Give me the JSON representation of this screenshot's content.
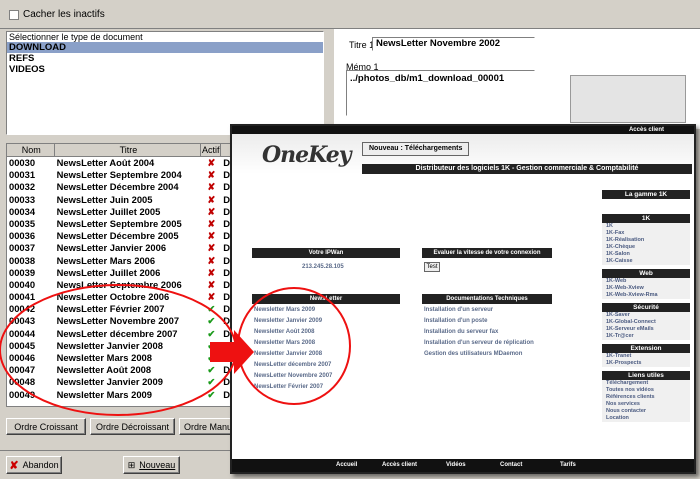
{
  "top": {
    "hide_inactive": "Cacher les inactifs"
  },
  "doc_types": {
    "label": "Sélectionner le type de document",
    "items": [
      "DOWNLOAD",
      "REFS",
      "VIDEOS"
    ]
  },
  "columns": {
    "nom": "Nom",
    "titre": "Titre",
    "actif": "Actif",
    "extra": "D"
  },
  "rows": [
    {
      "nom": "00030",
      "titre": "NewsLetter Août 2004",
      "actif": "✘"
    },
    {
      "nom": "00031",
      "titre": "NewsLetter Septembre 2004",
      "actif": "✘"
    },
    {
      "nom": "00032",
      "titre": "NewsLetter Décembre 2004",
      "actif": "✘"
    },
    {
      "nom": "00033",
      "titre": "NewsLetter Juin 2005",
      "actif": "✘"
    },
    {
      "nom": "00034",
      "titre": "NewsLetter Juillet 2005",
      "actif": "✘"
    },
    {
      "nom": "00035",
      "titre": "NewsLetter Septembre 2005",
      "actif": "✘"
    },
    {
      "nom": "00036",
      "titre": "NewsLetter Décembre 2005",
      "actif": "✘"
    },
    {
      "nom": "00037",
      "titre": "NewsLetter Janvier 2006",
      "actif": "✘"
    },
    {
      "nom": "00038",
      "titre": "NewsLetter Mars 2006",
      "actif": "✘"
    },
    {
      "nom": "00039",
      "titre": "NewsLetter Juillet 2006",
      "actif": "✘"
    },
    {
      "nom": "00040",
      "titre": "NewsLetter Septembre 2006",
      "actif": "✘"
    },
    {
      "nom": "00041",
      "titre": "NewsLetter Octobre 2006",
      "actif": "✘"
    },
    {
      "nom": "00042",
      "titre": "NewsLetter Février 2007",
      "actif": "✔"
    },
    {
      "nom": "00043",
      "titre": "NewsLetter Novembre 2007",
      "actif": "✔"
    },
    {
      "nom": "00044",
      "titre": "NewsLetter décembre 2007",
      "actif": "✔"
    },
    {
      "nom": "00045",
      "titre": "Newsletter Janvier 2008",
      "actif": "✔"
    },
    {
      "nom": "00046",
      "titre": "Newsletter Mars 2008",
      "actif": "✔"
    },
    {
      "nom": "00047",
      "titre": "Newsletter Août 2008",
      "actif": "✔"
    },
    {
      "nom": "00048",
      "titre": "Newsletter Janvier 2009",
      "actif": "✔"
    },
    {
      "nom": "00049",
      "titre": "Newsletter Mars 2009",
      "actif": "✔"
    }
  ],
  "sort": {
    "asc": "Ordre Croissant",
    "desc": "Ordre Décroissant",
    "manual": "Ordre Manue"
  },
  "bottom": {
    "cancel": "Abandon",
    "new": "Nouveau"
  },
  "detail": {
    "titre_label": "Titre 1",
    "titre_value": "NewsLetter Novembre 2002",
    "memo_label": "Mémo 1",
    "memo_value": "../photos_db/m1_download_00001"
  },
  "web": {
    "espace": "Accès client",
    "nav": "Nouveau : Téléchargements",
    "strip": "Distributeur des logiciels 1K - Gestion commerciale & Comptabilité",
    "ip_head": "Votre IPWan",
    "ip_value": "213.245.28.105",
    "speed_head": "Evaluer la vitesse de votre connexion",
    "test": "Test",
    "news_head": "NewsLetter",
    "news": [
      "Newsletter Mars 2009",
      "Newsletter Janvier 2009",
      "Newsletter Août 2008",
      "Newsletter Mars 2008",
      "Newsletter Janvier 2008",
      "NewsLetter décembre 2007",
      "NewsLetter Novembre 2007",
      "NewsLetter Février 2007"
    ],
    "docs_head": "Documentations Techniques",
    "docs": [
      "Installation d'un serveur",
      "Installation d'un poste",
      "Installation du serveur fax",
      "Installation d'un serveur de réplication",
      "Gestion des utilisateurs MDaemon"
    ],
    "gamme": "La gamme 1K",
    "side": [
      {
        "head": "1K",
        "items": [
          "1K",
          "1K-Fax",
          "1K-Réalisation",
          "1K-Chèque",
          "1K-Salon",
          "1K-Caisse"
        ]
      },
      {
        "head": "Web",
        "items": [
          "1K-Web",
          "1K-Web-Xview",
          "1K-Web-Xview-Rma"
        ]
      },
      {
        "head": "Sécurité",
        "items": [
          "1K-Saver",
          "1K-Global-Connect",
          "1K-Serveur eMails",
          "1K-Tr@cer"
        ]
      },
      {
        "head": "Extension",
        "items": [
          "1K-Tranet",
          "1K-Prospects"
        ]
      },
      {
        "head": "Liens utiles",
        "items": [
          "Téléchargement",
          "Toutes nos vidéos",
          "Références clients",
          "Nos services",
          "Nous contacter",
          "Location"
        ]
      }
    ],
    "footer": [
      "Accueil",
      "Accès client",
      "Vidéos",
      "Contact",
      "Tarifs"
    ]
  }
}
